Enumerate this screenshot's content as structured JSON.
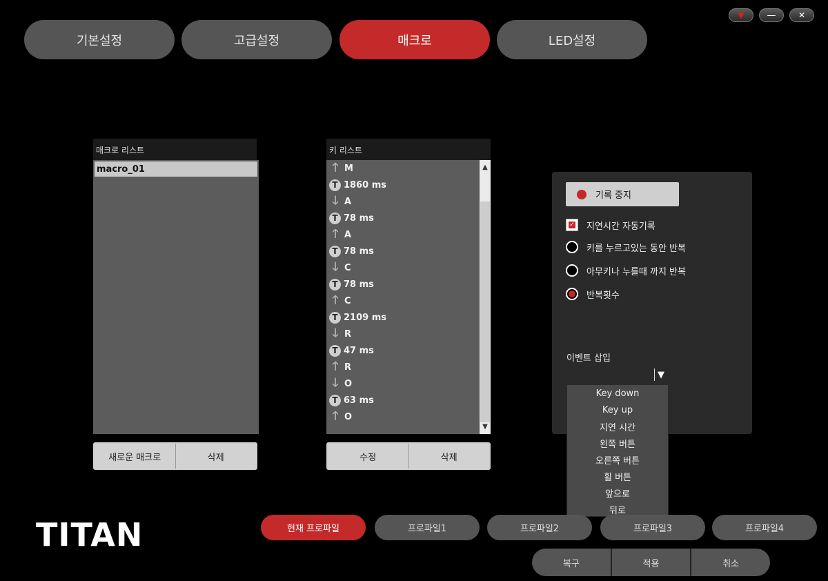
{
  "window_controls": {
    "dropdown": "▼",
    "minimize": "—",
    "close": "✕"
  },
  "tabs": [
    {
      "label": "기본설정"
    },
    {
      "label": "고급설정"
    },
    {
      "label": "매크로"
    },
    {
      "label": "LED설정"
    }
  ],
  "macro_list": {
    "header": "매크로 리스트",
    "items": [
      "macro_01"
    ],
    "new_button": "새로운 매크로",
    "delete_button": "삭제"
  },
  "key_list": {
    "header": "키 리스트",
    "items": [
      {
        "type": "up",
        "text": "M"
      },
      {
        "type": "time",
        "text": "1860 ms"
      },
      {
        "type": "down",
        "text": "A"
      },
      {
        "type": "time",
        "text": "78 ms"
      },
      {
        "type": "up",
        "text": "A"
      },
      {
        "type": "time",
        "text": "78 ms"
      },
      {
        "type": "down",
        "text": "C"
      },
      {
        "type": "time",
        "text": "78 ms"
      },
      {
        "type": "up",
        "text": "C"
      },
      {
        "type": "time",
        "text": "2109 ms"
      },
      {
        "type": "down",
        "text": "R"
      },
      {
        "type": "time",
        "text": "47 ms"
      },
      {
        "type": "up",
        "text": "R"
      },
      {
        "type": "down",
        "text": "O"
      },
      {
        "type": "time",
        "text": "63 ms"
      },
      {
        "type": "up",
        "text": "O"
      }
    ],
    "edit_button": "수정",
    "delete_button": "삭제",
    "icon_up": "🡑",
    "icon_down": "🡓",
    "icon_time": "T"
  },
  "settings": {
    "record_button": "기록 중지",
    "auto_delay": "지연시간 자동기록",
    "options": [
      {
        "label": "키를 누르고있는 동안 반복",
        "selected": false
      },
      {
        "label": "아무키나 누를때 까지 반복",
        "selected": false
      },
      {
        "label": "반복횟수",
        "selected": true
      }
    ],
    "event_insert_label": "이벤트 삽입",
    "dropdown_arrow": "▼",
    "event_options": [
      "Key down",
      "Key up",
      "지연 시간",
      "왼쪽 버튼",
      "오른쪽 버튼",
      "휠 버튼",
      "앞으로",
      "뒤로"
    ]
  },
  "logo": "TITAN",
  "profiles": [
    "현재 프로파일",
    "프로파일1",
    "프로파일2",
    "프로파일3",
    "프로파일4"
  ],
  "footer": {
    "restore": "복구",
    "apply": "적용",
    "cancel": "취소"
  },
  "colors": {
    "accent": "#c42a2a",
    "button_gray": "#555555"
  }
}
